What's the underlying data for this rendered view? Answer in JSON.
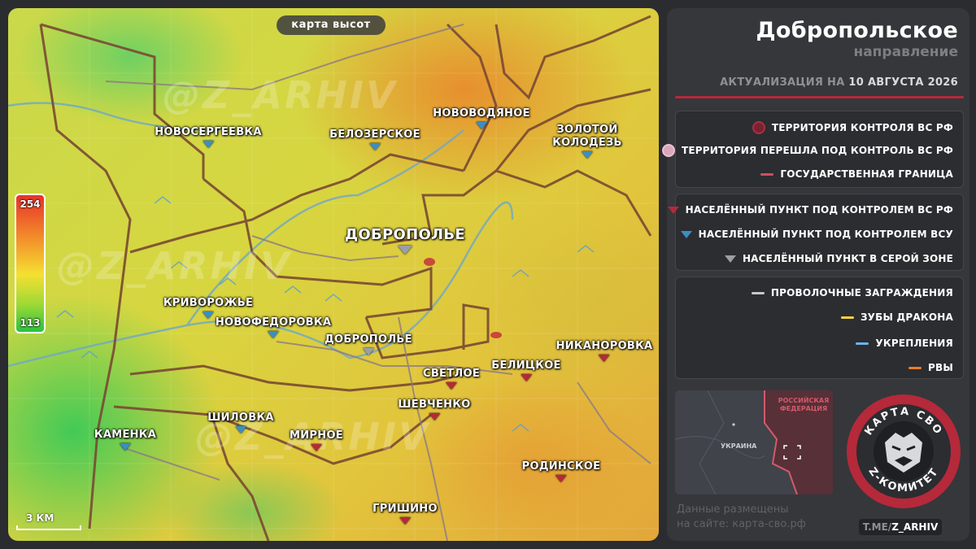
{
  "map": {
    "mode_tag": "карта высот",
    "watermark": "@Z_ARHIV",
    "elevation_scale": {
      "max": "254",
      "min": "113"
    },
    "scale_label": "3 КМ",
    "settlements": [
      {
        "name": "НОВОСЕРГЕЕВКА",
        "status": "ua"
      },
      {
        "name": "БЕЛОЗЕРСКОЕ",
        "status": "ua"
      },
      {
        "name": "НОВОВОДЯНОЕ",
        "status": "ua"
      },
      {
        "name": "ЗОЛОТОЙ КОЛОДЕЗЬ",
        "status": "ua"
      },
      {
        "name": "ДОБРОПОЛЬЕ",
        "status": "gray"
      },
      {
        "name": "КРИВОРОЖЬЕ",
        "status": "ua"
      },
      {
        "name": "НОВОФЕДОРОВКА",
        "status": "ua"
      },
      {
        "name": "ДОБРОПОЛЬЕ",
        "status": "gray"
      },
      {
        "name": "НИКАНОРОВКА",
        "status": "ru"
      },
      {
        "name": "БЕЛИЦКОЕ",
        "status": "ru"
      },
      {
        "name": "СВЕТЛОЕ",
        "status": "ru"
      },
      {
        "name": "ШЕВЧЕНКО",
        "status": "ru"
      },
      {
        "name": "КАМЕНКА",
        "status": "ua"
      },
      {
        "name": "ШИЛОВКА",
        "status": "ua"
      },
      {
        "name": "МИРНОЕ",
        "status": "ru"
      },
      {
        "name": "РОДИНСКОЕ",
        "status": "ru"
      },
      {
        "name": "ГРИШИНО",
        "status": "ru"
      }
    ]
  },
  "panel": {
    "title": "Добропольское",
    "subtitle": "направление",
    "update_prefix": "АКТУАЛИЗАЦИЯ НА",
    "update_date": "10 АВГУСТА 2026",
    "legend_territory": [
      {
        "label": "ТЕРРИТОРИЯ КОНТРОЛЯ ВС РФ"
      },
      {
        "label": "ТЕРРИТОРИЯ ПЕРЕШЛА ПОД КОНТРОЛЬ ВС РФ"
      },
      {
        "label": "ГОСУДАРСТВЕННАЯ ГРАНИЦА"
      }
    ],
    "legend_settlements": [
      {
        "label": "НАСЕЛЁННЫЙ ПУНКТ ПОД КОНТРОЛЕМ ВС РФ"
      },
      {
        "label": "НАСЕЛЁННЫЙ ПУНКТ ПОД КОНТРОЛЕМ ВСУ"
      },
      {
        "label": "НАСЕЛЁННЫЙ ПУНКТ В СЕРОЙ ЗОНЕ"
      }
    ],
    "legend_fortifications": [
      {
        "label": "ПРОВОЛОЧНЫЕ ЗАГРАЖДЕНИЯ"
      },
      {
        "label": "ЗУБЫ ДРАКОНА"
      },
      {
        "label": "УКРЕПЛЕНИЯ"
      },
      {
        "label": "РВЫ"
      }
    ],
    "minimap": {
      "russia_label": "РОССИЙСКАЯ ФЕДЕРАЦИЯ",
      "ukraine_label": "УКРАИНА"
    },
    "emblem": {
      "top_text": "КАРТА СВО",
      "bottom_text": "Z-КОМИТЕТ"
    },
    "site_line1": "Данные размещены",
    "site_line2": "на сайте: карта-сво.рф",
    "tme_prefix": "T.ME/",
    "tme_handle": "Z_ARHIV"
  },
  "colors": {
    "ru_control": "#b5293a",
    "ua_control": "#3a8fc2",
    "gray_zone": "#9a9fa6",
    "border": "#c9525f",
    "wire": "#c8c8cc",
    "dragon_teeth": "#f0d43a",
    "fortifications": "#6ab4e8",
    "ditches": "#f07a2a"
  }
}
